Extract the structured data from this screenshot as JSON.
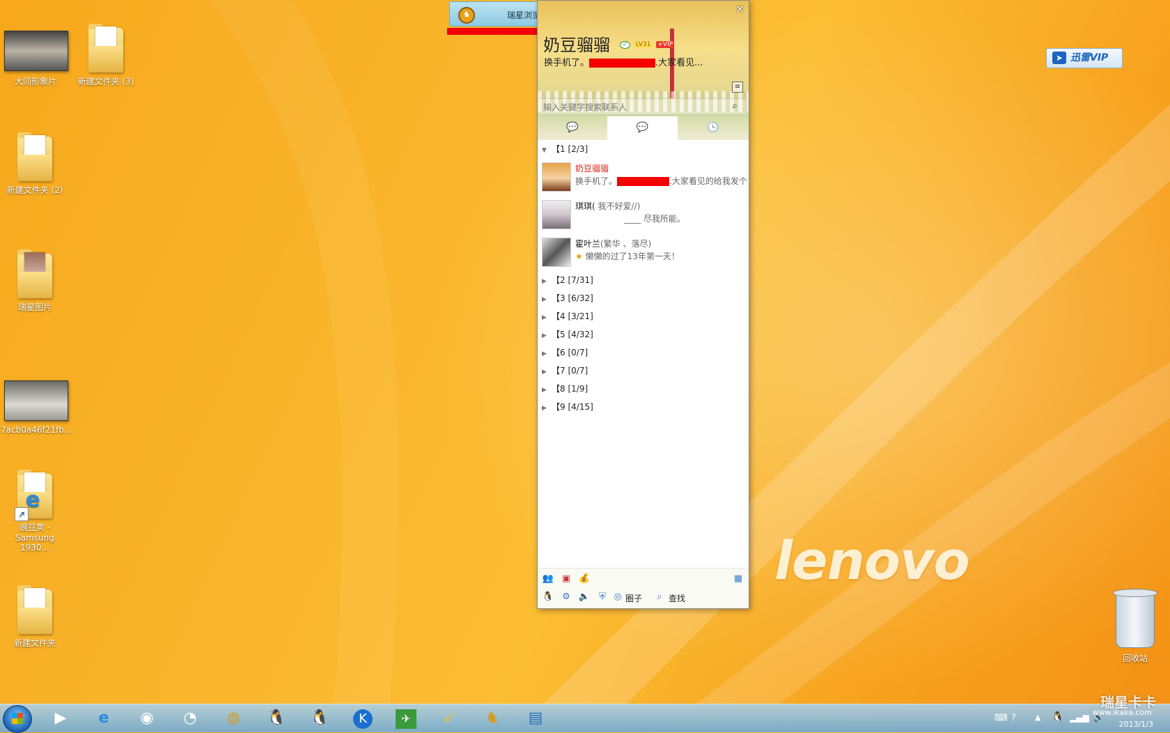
{
  "desktop": {
    "icons": [
      {
        "label": "大同形象片"
      },
      {
        "label": "新建文件夹 (3)"
      },
      {
        "label": "新建文件夹 (2)"
      },
      {
        "label": "瑞星图片"
      },
      {
        "label": "7acb0a46f21fb..."
      },
      {
        "label": "豌豆荚 -",
        "label2": "Samsung 1930..."
      },
      {
        "label": "新建文件夹"
      }
    ],
    "recycle_bin": "回收站",
    "brand": "lenovo"
  },
  "notice": {
    "text": "瑞星浏览器防护正在保护您的IE浏览器。"
  },
  "qq": {
    "nickname": "奶豆骝骝",
    "level_badge": "LV31",
    "vip_badge": "+VIP",
    "signature_start": "换手机了。",
    "signature_end": ".大家看见...",
    "search_placeholder": "输入关键字搜索联系人",
    "groups": [
      {
        "name": "【1",
        "count": "[2/3]"
      },
      {
        "name": "【2",
        "count": "[7/31]"
      },
      {
        "name": "【3",
        "count": "[6/32]"
      },
      {
        "name": "【4",
        "count": "[3/21]"
      },
      {
        "name": "【5",
        "count": "[4/32]"
      },
      {
        "name": "【6",
        "count": "[0/7]"
      },
      {
        "name": "【7",
        "count": "[0/7]"
      },
      {
        "name": "【8",
        "count": "[1/9]"
      },
      {
        "name": "【9",
        "count": "[4/15]"
      }
    ],
    "contacts": [
      {
        "name": "奶豆骝骝",
        "status_start": "换手机了。",
        "status_end": ".大家看见的给我发个"
      },
      {
        "name": "琪琪(",
        "name_tail": "我不好爱//)",
        "status": "____    尽我所能。"
      },
      {
        "name": "霍叶兰",
        "name_tail": "(繁华 、落尽)",
        "status": "懒懒的过了13年第一天！"
      }
    ],
    "bottom": {
      "circle_label": "圈子",
      "find_label": "查找"
    }
  },
  "xunlei": {
    "label": "迅雷VIP"
  },
  "taskbar": {
    "date": "2013/1/3",
    "watermark": "瑞星卡卡",
    "watermark_url": "www.ikaka.com"
  }
}
